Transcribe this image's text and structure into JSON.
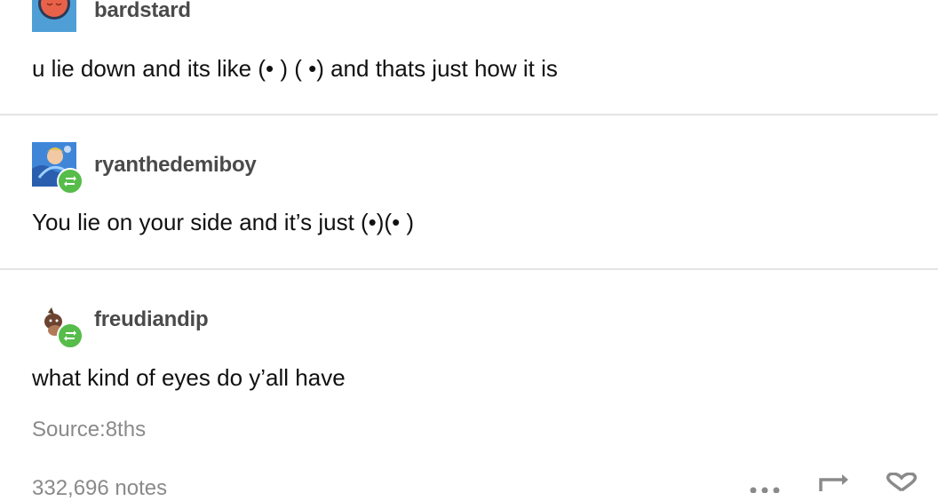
{
  "posts": [
    {
      "username": "bardstard",
      "text": "u lie down and its like (• ) ( •) and thats just how it is",
      "avatar": "sleeping-face-avatar",
      "reblog_badge": false
    },
    {
      "username": "ryanthedemiboy",
      "text": "You lie on your side and it’s just (•)(• )",
      "avatar": "illustrated-person-avatar",
      "reblog_badge": true
    },
    {
      "username": "freudiandip",
      "text": "what kind of eyes do y’all have",
      "avatar": "cat-avatar",
      "reblog_badge": true
    }
  ],
  "footer": {
    "source": "Source:8ths",
    "notes": "332,696 notes"
  },
  "actions": {
    "more_icon": "more-dots-icon",
    "reblog_icon": "reblog-icon",
    "like_icon": "heart-icon"
  },
  "colors": {
    "username": "#4a4a4a",
    "meta": "#8a8a8a",
    "reblog_green": "#56bc4a",
    "divider": "#e4e4e4"
  }
}
